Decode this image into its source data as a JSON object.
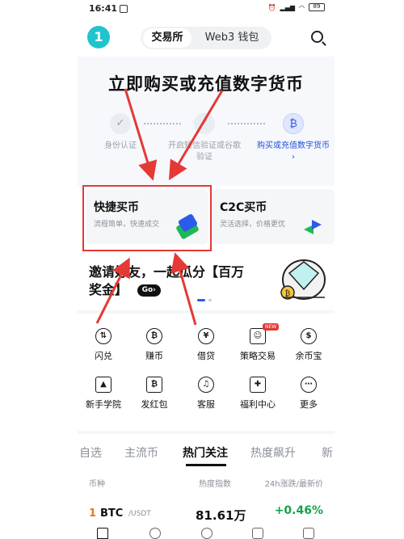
{
  "status_bar": {
    "time": "16:41",
    "battery": "89"
  },
  "header": {
    "avatar_initial": "1",
    "segment_options": [
      "交易所",
      "Web3 钱包"
    ],
    "active_segment": "交易所"
  },
  "banner": {
    "headline": "立即购买或充值数字货币",
    "steps": [
      {
        "label": "身份认证",
        "active": false
      },
      {
        "label": "开启短信验证或谷歌验证",
        "active": false
      },
      {
        "label": "购买或充值数字货币 ›",
        "active": true
      }
    ]
  },
  "cards": [
    {
      "title": "快捷买币",
      "subtitle": "流程简单，快速成交"
    },
    {
      "title": "C2C买币",
      "subtitle": "灵活选择，价格更优"
    }
  ],
  "invite": {
    "text": "邀请好友，一起瓜分【百万奖金】",
    "go_label": "Go›"
  },
  "grid": [
    {
      "label": "闪兑",
      "icon": "swap-icon"
    },
    {
      "label": "赚币",
      "icon": "bitcoin-icon"
    },
    {
      "label": "借贷",
      "icon": "loan-icon"
    },
    {
      "label": "策略交易",
      "icon": "robot-icon",
      "badge": "NEW"
    },
    {
      "label": "余币宝",
      "icon": "moneybag-icon"
    },
    {
      "label": "新手学院",
      "icon": "graduation-cap-icon"
    },
    {
      "label": "发红包",
      "icon": "red-packet-icon"
    },
    {
      "label": "客服",
      "icon": "headset-icon"
    },
    {
      "label": "福利中心",
      "icon": "gift-icon"
    },
    {
      "label": "更多",
      "icon": "more-icon"
    }
  ],
  "market_tabs": [
    "自选",
    "主流币",
    "热门关注",
    "热度飙升",
    "新"
  ],
  "active_market_tab": "热门关注",
  "columns": [
    "币种",
    "热度指数",
    "24h涨跌/最新价"
  ],
  "rows": [
    {
      "rank": "1",
      "symbol": "BTC",
      "pair": "/USDT",
      "heat": "81.61万",
      "change": "+0.46%"
    }
  ],
  "colors": {
    "accent": "#2b5bea",
    "annotation": "#e53935",
    "positive": "#14a34a",
    "avatar": "#20c4cf"
  }
}
